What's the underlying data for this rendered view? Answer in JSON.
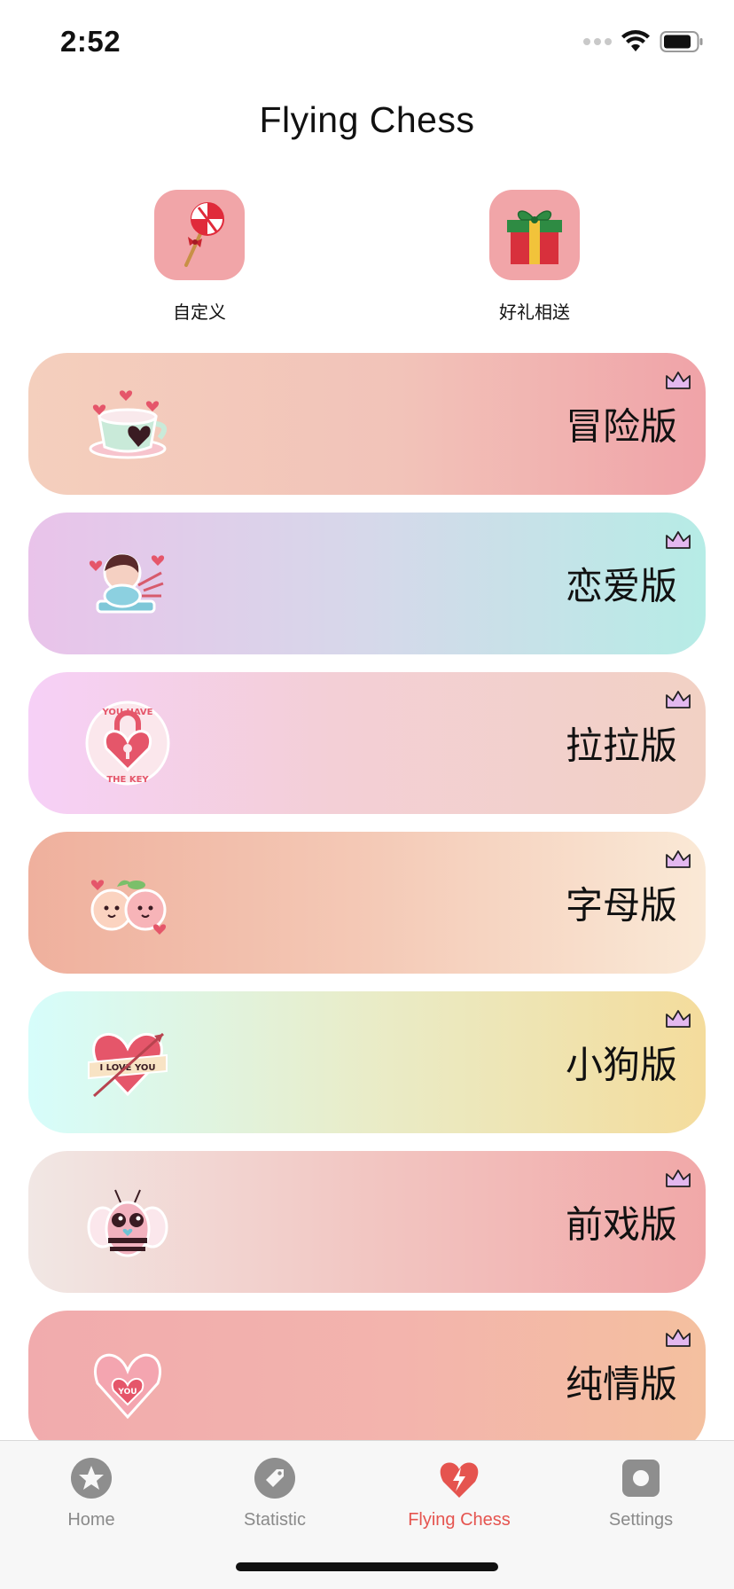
{
  "status": {
    "time": "2:52"
  },
  "title": "Flying Chess",
  "quick_actions": [
    {
      "label": "自定义",
      "icon": "lollipop-icon"
    },
    {
      "label": "好礼相送",
      "icon": "gift-box-icon"
    }
  ],
  "cards": [
    {
      "label": "冒险版",
      "sticker": "teacup-heart-sticker",
      "gradient": [
        "#f4cdbb",
        "#f2a9ad"
      ]
    },
    {
      "label": "恋爱版",
      "sticker": "cupid-boy-sticker",
      "gradient": [
        "#e8c5ea",
        "#b8ece6"
      ]
    },
    {
      "label": "拉拉版",
      "sticker": "heart-lock-sticker",
      "gradient": [
        "#f6d1f6",
        "#f3d2c6"
      ]
    },
    {
      "label": "字母版",
      "sticker": "peach-couple-sticker",
      "gradient": [
        "#f0b29f",
        "#fae7d2"
      ]
    },
    {
      "label": "小狗版",
      "sticker": "love-heart-banner-sticker",
      "gradient": [
        "#d6fdfb",
        "#f4dc9c"
      ]
    },
    {
      "label": "前戏版",
      "sticker": "love-bee-sticker",
      "gradient": [
        "#f1e7e4",
        "#f1a9a9"
      ]
    },
    {
      "label": "纯情版",
      "sticker": "heart-hands-sticker",
      "gradient": [
        "#f2adae",
        "#f4bf9f"
      ]
    }
  ],
  "tabs": [
    {
      "label": "Home",
      "icon": "star-icon",
      "active": false
    },
    {
      "label": "Statistic",
      "icon": "tag-icon",
      "active": false
    },
    {
      "label": "Flying Chess",
      "icon": "heart-bolt-icon",
      "active": true
    },
    {
      "label": "Settings",
      "icon": "settings-icon",
      "active": false
    }
  ],
  "colors": {
    "accent": "#e5544f",
    "inactive": "#8a8a8a",
    "tile": "#f1a5a8"
  }
}
